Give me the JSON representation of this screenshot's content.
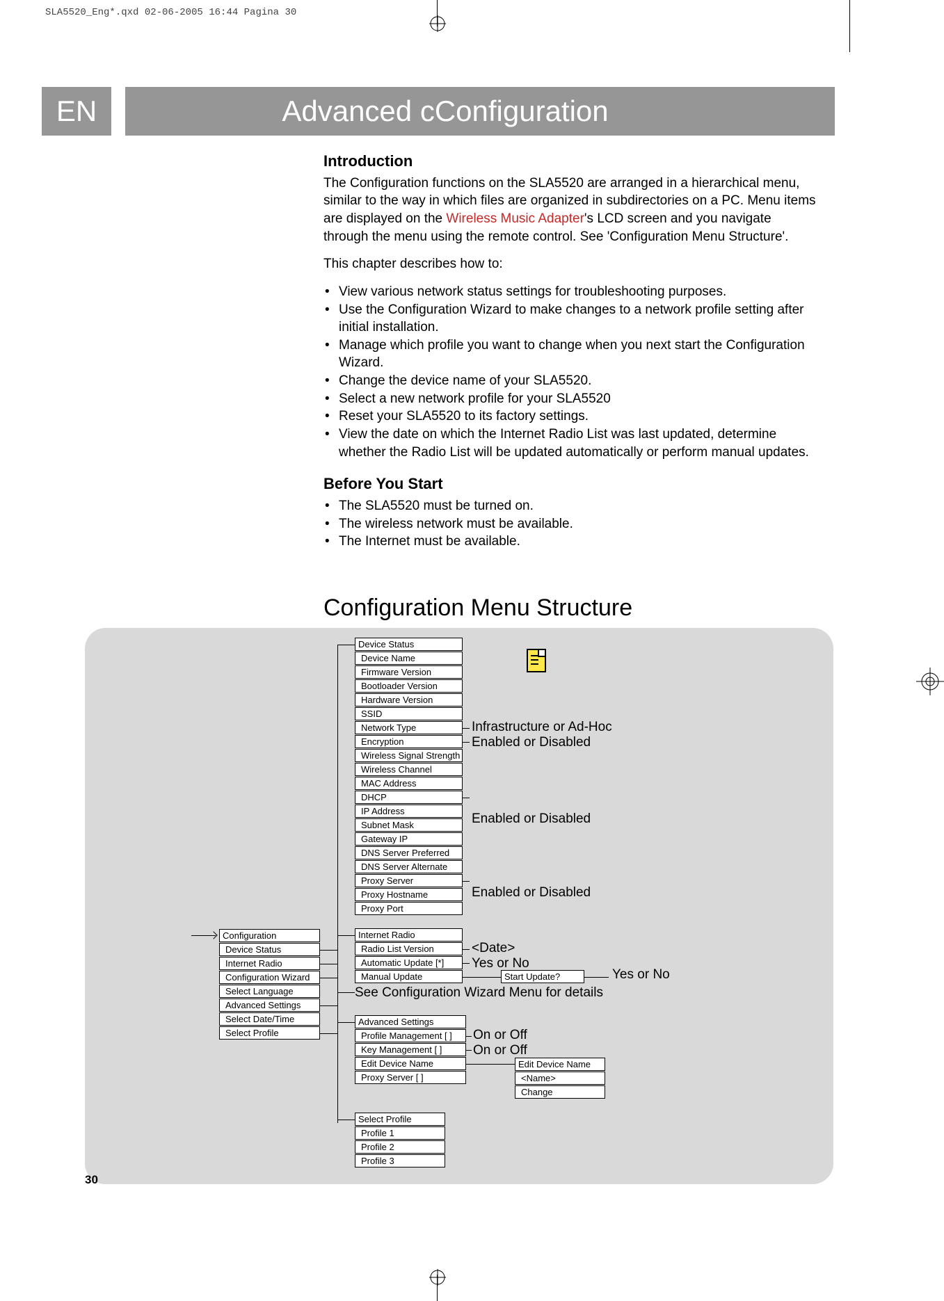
{
  "print_header": "SLA5520_Eng*.qxd  02-06-2005  16:44  Pagina 30",
  "lang": "EN",
  "title": "Advanced cConfiguration",
  "page_num": "30",
  "intro": {
    "heading": "Introduction",
    "p1a": "The Configuration functions on the SLA5520 are arranged in a hierarchical menu, similar to the way in which files are organized in subdirectories on a PC. Menu items are displayed on the ",
    "p1_red": "Wireless Music Adapter",
    "p1b": "'s LCD screen and you navigate through the menu using the remote control. See 'Configuration Menu Structure'.",
    "p2": "This chapter describes how to:",
    "bullets": [
      "View various network status settings for troubleshooting purposes.",
      "Use the Configuration Wizard to make changes to a network profile setting after initial installation.",
      "Manage which profile you want to change when you next start the Configuration Wizard.",
      "Change the device name of your SLA5520.",
      "Select a new network profile for your SLA5520",
      "Reset your SLA5520 to its factory settings.",
      "View the date on which the Internet Radio List was last updated, determine whether the Radio List will be updated automatically or perform manual updates."
    ]
  },
  "before": {
    "heading": "Before You Start",
    "bullets": [
      "The SLA5520 must be turned on.",
      "The wireless network must be available.",
      "The Internet must be available."
    ]
  },
  "section2": "Configuration Menu Structure",
  "menu_root": [
    "Configuration",
    "Device Status",
    "Internet Radio",
    "Configuration Wizard",
    "Select Language",
    "Advanced Settings",
    "Select Date/Time",
    "Select Profile"
  ],
  "device_status": {
    "header": "Device Status",
    "items": [
      "Device Name",
      "Firmware Version",
      "Bootloader Version",
      "Hardware Version",
      "SSID",
      "Network Type",
      "Encryption",
      "Wireless Signal Strength",
      "Wireless Channel",
      "MAC Address",
      "DHCP",
      "IP Address",
      "Subnet Mask",
      "Gateway IP",
      "DNS Server Preferred",
      "DNS Server Alternate",
      "Proxy Server",
      "Proxy Hostname",
      "Proxy Port"
    ]
  },
  "ds_labels": {
    "network_type": "Infrastructure or Ad-Hoc",
    "encryption": "Enabled or Disabled",
    "dhcp": "Enabled or Disabled",
    "proxy": "Enabled or Disabled"
  },
  "internet_radio": {
    "header": "Internet Radio",
    "items": [
      "Radio List Version",
      "Automatic Update [*]",
      "Manual Update"
    ]
  },
  "ir_labels": {
    "date": "<Date>",
    "yesno": "Yes or No",
    "start": "Start Update?",
    "yesno2": "Yes or No"
  },
  "cfg_wizard_note": "See Configuration Wizard Menu for details",
  "advanced": {
    "header": "Advanced Settings",
    "items": [
      "Profile Management [ ]",
      "Key Management [ ]",
      "Edit Device Name",
      "Proxy Server [ ]"
    ]
  },
  "adv_labels": {
    "onoff1": "On or Off",
    "onoff2": "On or Off"
  },
  "edit_name": {
    "header": "Edit Device Name",
    "items": [
      "<Name>",
      "Change"
    ]
  },
  "select_profile": {
    "header": "Select Profile",
    "items": [
      "Profile 1",
      "Profile 2",
      "Profile 3"
    ]
  }
}
